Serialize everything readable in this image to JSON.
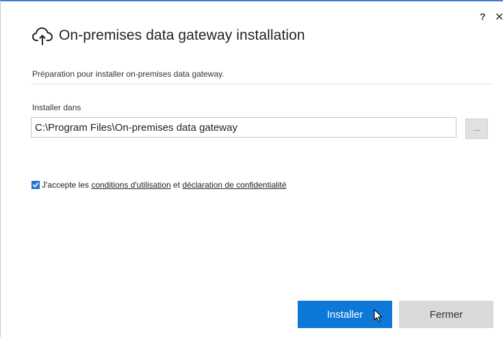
{
  "dialog": {
    "title": "On-premises data gateway installation",
    "help_label": "?",
    "close_label": "✕",
    "title_icon": "cloud-upload-icon"
  },
  "main": {
    "subtitle": "Préparation pour installer on-premises data gateway.",
    "install_label": "Installer dans",
    "install_path": "C:\\Program Files\\On-premises data gateway",
    "browse_label": "..."
  },
  "consent": {
    "checked": true,
    "prefix": "J'accepte les ",
    "terms_link": "conditions d'utilisation",
    "middle": " et ",
    "privacy_link": "déclaration de confidentialité"
  },
  "footer": {
    "primary_label": "Installer",
    "secondary_label": "Fermer"
  },
  "colors": {
    "accent": "#0e78d8",
    "secondary": "#d9d9d9"
  }
}
